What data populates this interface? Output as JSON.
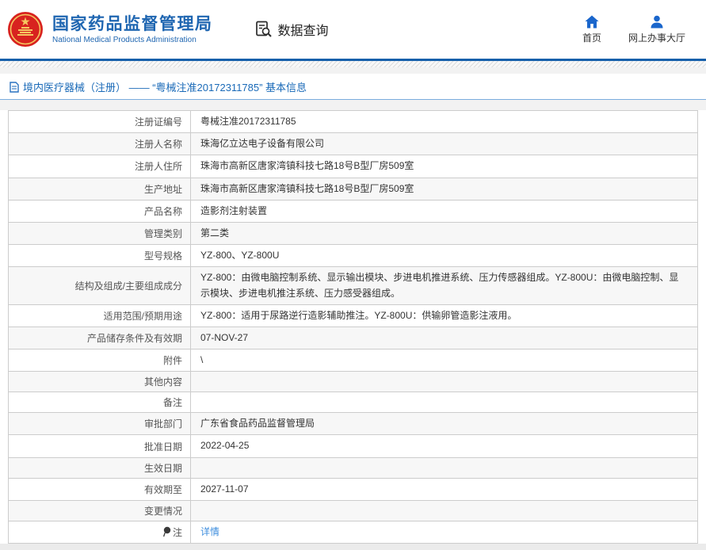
{
  "header": {
    "title_cn": "国家药品监督管理局",
    "title_en": "National Medical Products Administration",
    "data_query_label": "数据查询",
    "nav": {
      "home": "首页",
      "service_hall": "网上办事大厅"
    }
  },
  "breadcrumb": {
    "text": "境内医疗器械（注册） ——  “粤械注准20172311785”  基本信息"
  },
  "table": {
    "rows": [
      {
        "label": "注册证编号",
        "value": "粤械注准20172311785"
      },
      {
        "label": "注册人名称",
        "value": "珠海亿立达电子设备有限公司"
      },
      {
        "label": "注册人住所",
        "value": "珠海市高新区唐家湾镇科技七路18号B型厂房509室"
      },
      {
        "label": "生产地址",
        "value": "珠海市高新区唐家湾镇科技七路18号B型厂房509室"
      },
      {
        "label": "产品名称",
        "value": "造影剂注射装置"
      },
      {
        "label": "管理类别",
        "value": "第二类"
      },
      {
        "label": "型号规格",
        "value": "YZ-800、YZ-800U"
      },
      {
        "label": "结构及组成/主要组成成分",
        "value": "YZ-800：由微电脑控制系统、显示输出模块、步进电机推进系统、压力传感器组成。YZ-800U：由微电脑控制、显示模块、步进电机推注系统、压力感受器组成。"
      },
      {
        "label": "适用范围/预期用途",
        "value": "YZ-800：适用于尿路逆行造影辅助推注。YZ-800U：供输卵管造影注液用。"
      },
      {
        "label": "产品储存条件及有效期",
        "value": "07-NOV-27"
      },
      {
        "label": "附件",
        "value": "\\"
      },
      {
        "label": "其他内容",
        "value": ""
      },
      {
        "label": "备注",
        "value": ""
      },
      {
        "label": "审批部门",
        "value": "广东省食品药品监督管理局"
      },
      {
        "label": "批准日期",
        "value": "2022-04-25"
      },
      {
        "label": "生效日期",
        "value": ""
      },
      {
        "label": "有效期至",
        "value": "2027-11-07"
      },
      {
        "label": "变更情况",
        "value": ""
      },
      {
        "label": "注",
        "value": "详情",
        "link": true,
        "icon": "pin"
      }
    ]
  },
  "icons": {
    "emblem": "national-emblem-icon",
    "data_query": "doc-magnifier-icon",
    "home": "home-icon",
    "service_hall": "person-icon",
    "breadcrumb": "document-icon",
    "note_row": "note-pin-icon"
  },
  "colors": {
    "brand_blue": "#1f66b1",
    "rule_blue": "#1660ab",
    "breadcrumb_blue": "#1a6ab8",
    "nav_icon_blue": "#1a66cc",
    "link_blue": "#3e8ede",
    "emblem_red": "#d8231f",
    "emblem_gold": "#f5c860",
    "table_border": "#cccccc",
    "alt_row_bg": "#f7f7f7"
  }
}
